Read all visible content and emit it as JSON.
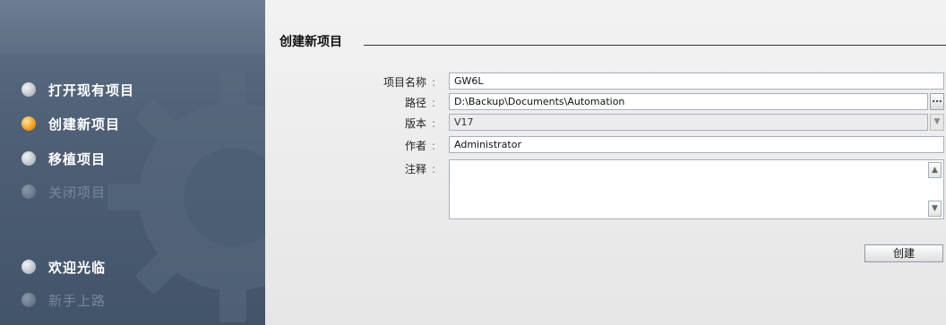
{
  "sidebar": {
    "items": [
      {
        "label": "打开现有项目"
      },
      {
        "label": "创建新项目"
      },
      {
        "label": "移植项目"
      },
      {
        "label": "关闭项目"
      },
      {
        "label": "欢迎光临"
      },
      {
        "label": "新手上路"
      }
    ]
  },
  "main": {
    "title": "创建新项目",
    "fields": {
      "project_name": {
        "label": "项目名称",
        "value": "GW6L"
      },
      "path": {
        "label": "路径",
        "value": "D:\\Backup\\Documents\\Automation",
        "browse_label": "..."
      },
      "version": {
        "label": "版本",
        "value": "V17"
      },
      "author": {
        "label": "作者",
        "value": "Administrator"
      },
      "comment": {
        "label": "注释",
        "value": ""
      }
    },
    "colon": ":",
    "create_button": "创建"
  },
  "colors": {
    "sidebar_bg": "#4f6076",
    "active_dot": "#f7a21c",
    "inactive_dot": "#c3c9d1",
    "main_bg": "#eaeaea"
  },
  "icons": {
    "gear": "gear-icon",
    "scroll_up": "chevron-up-icon",
    "scroll_down": "chevron-down-icon",
    "dropdown": "chevron-down-icon"
  }
}
